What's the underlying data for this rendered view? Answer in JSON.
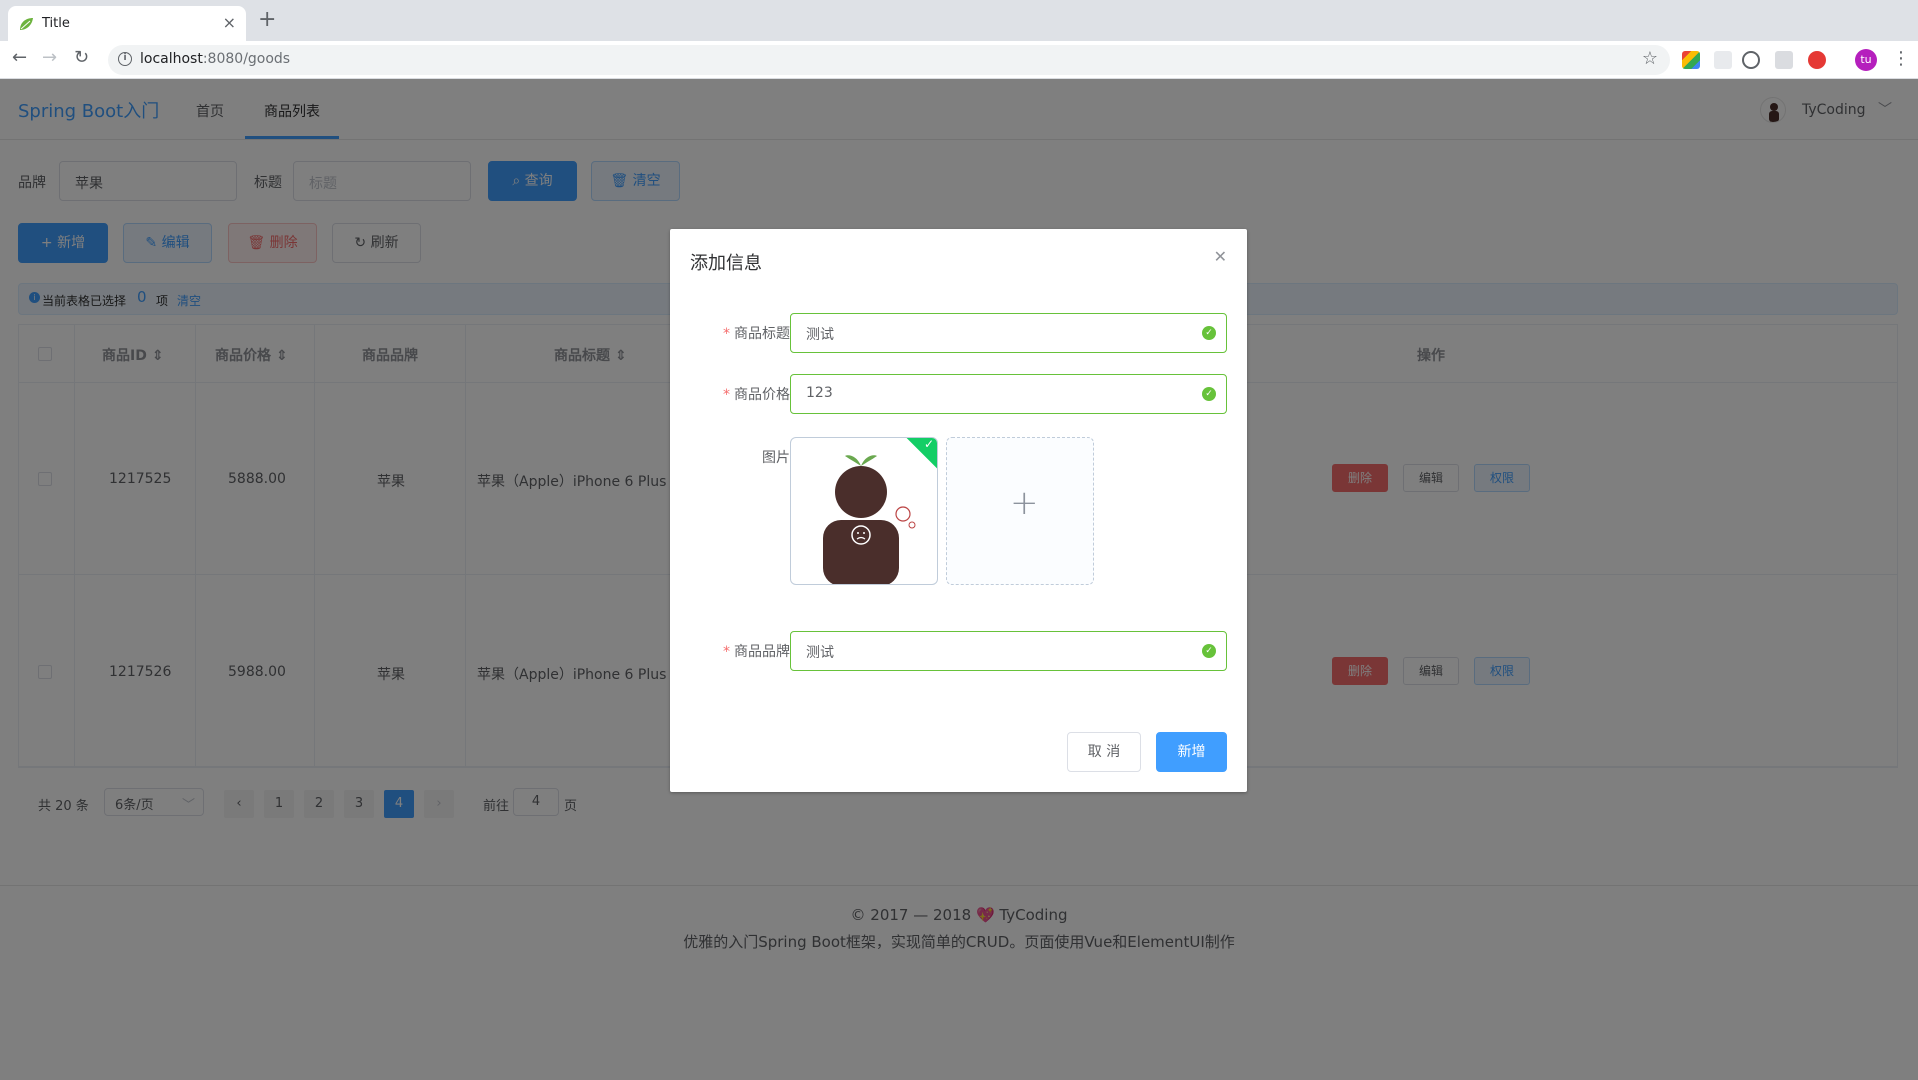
{
  "browser": {
    "tab_title": "Title",
    "url_host": "localhost",
    "url_rest": ":8080/goods",
    "profile_initials": "tu"
  },
  "app": {
    "brand": "Spring Boot入门",
    "nav": [
      "首页",
      "商品列表"
    ],
    "user": "TyCoding",
    "search": {
      "brand_label": "品牌",
      "brand_value": "苹果",
      "title_label": "标题",
      "title_placeholder": "标题",
      "query_btn": "查询",
      "clear_btn": "清空"
    },
    "actions": [
      "新增",
      "编辑",
      "删除",
      "刷新"
    ],
    "selection": {
      "prefix": "当前表格已选择",
      "count": "0",
      "suffix": "项",
      "clear": "清空"
    },
    "table": {
      "headers": [
        "商品ID",
        "商品价格",
        "商品品牌",
        "商品标题",
        "操作"
      ],
      "rows": [
        {
          "id": "1217525",
          "price": "5888.00",
          "brand": "苹果",
          "title": "苹果（Apple）iPhone 6 Plus (A"
        },
        {
          "id": "1217526",
          "price": "5988.00",
          "brand": "苹果",
          "title": "苹果（Apple）iPhone 6 Plus (A"
        }
      ],
      "row_actions": [
        "删除",
        "编辑",
        "权限"
      ]
    },
    "pagination": {
      "total": "共 20 条",
      "page_size": "6条/页",
      "pages": [
        "1",
        "2",
        "3",
        "4"
      ],
      "current": "4",
      "goto_label": "前往",
      "goto_value": "4",
      "goto_suffix": "页"
    },
    "footer": {
      "line1": "© 2017 — 2018 💖 TyCoding",
      "line2": "优雅的入门Spring Boot框架，实现简单的CRUD。页面使用Vue和ElementUI制作"
    }
  },
  "dialog": {
    "title": "添加信息",
    "fields": {
      "title_label": "商品标题",
      "title_value": "测试",
      "price_label": "商品价格",
      "price_value": "123",
      "image_label": "图片",
      "brand_label": "商品品牌",
      "brand_value": "测试"
    },
    "cancel": "取 消",
    "submit": "新增"
  },
  "colors": {
    "primary": "#409eff",
    "success": "#67c23a",
    "danger": "#f56c6c"
  }
}
